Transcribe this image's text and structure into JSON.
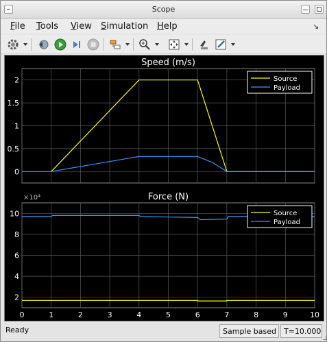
{
  "window": {
    "title": "Scope"
  },
  "menu": {
    "file": "File",
    "tools": "Tools",
    "view": "View",
    "simulation": "Simulation",
    "help": "Help"
  },
  "toolbar": {
    "icons": [
      "gear-icon",
      "step-back-icon",
      "run-icon",
      "step-forward-icon",
      "stop-icon",
      "signal-selector-icon",
      "zoom-in-icon",
      "fit-axes-icon",
      "highlight-block-icon",
      "edit-properties-icon"
    ]
  },
  "status": {
    "ready": "Ready",
    "mode": "Sample based",
    "time": "T=10.000"
  },
  "colors": {
    "source": "#ffff00",
    "payload": "#3399ff",
    "background": "#000000",
    "axes_bg": "#000000",
    "grid": "#5a5a5a",
    "text": "#ffffff"
  },
  "chart_data": [
    {
      "type": "line",
      "title": "Speed (m/s)",
      "xlim": [
        0,
        10
      ],
      "ylim": [
        -0.25,
        2.25
      ],
      "yticks": [
        0,
        0.5,
        1,
        1.5,
        2
      ],
      "ytick_labels": [
        "0",
        "0.5",
        "1",
        "1.5",
        "2"
      ],
      "grid": true,
      "legend_position": "top-right",
      "series": [
        {
          "name": "Source",
          "color": "#ffff00",
          "x": [
            1,
            4,
            6,
            7,
            10
          ],
          "y": [
            0,
            2,
            2,
            0,
            0
          ]
        },
        {
          "name": "Payload",
          "color": "#3399ff",
          "x": [
            0,
            1,
            4,
            6,
            6.5,
            7,
            10
          ],
          "y": [
            0,
            0,
            0.33,
            0.33,
            0.2,
            0,
            0
          ]
        }
      ]
    },
    {
      "type": "line",
      "title": "Force (N)",
      "exponent_label": "×10⁴",
      "xlim": [
        0,
        10
      ],
      "ylim": [
        1,
        11
      ],
      "yticks": [
        2,
        4,
        6,
        8,
        10
      ],
      "ytick_labels": [
        "2",
        "4",
        "6",
        "8",
        "10"
      ],
      "xticks": [
        0,
        1,
        2,
        3,
        4,
        5,
        6,
        7,
        8,
        9,
        10
      ],
      "xtick_labels": [
        "0",
        "1",
        "2",
        "3",
        "4",
        "5",
        "6",
        "7",
        "8",
        "9",
        "10"
      ],
      "grid": true,
      "legend_position": "top-right",
      "series": [
        {
          "name": "Source",
          "color": "#ffff00",
          "x": [
            0,
            6,
            6,
            7,
            7,
            10
          ],
          "y": [
            1.7,
            1.7,
            1.65,
            1.65,
            1.7,
            1.7
          ]
        },
        {
          "name": "Payload",
          "color": "#3399ff",
          "x": [
            0,
            1,
            1.05,
            4,
            4.05,
            6,
            6.1,
            7,
            7.05,
            10
          ],
          "y": [
            9.7,
            9.7,
            9.8,
            9.8,
            9.7,
            9.6,
            9.4,
            9.45,
            9.7,
            9.7
          ]
        }
      ]
    }
  ]
}
